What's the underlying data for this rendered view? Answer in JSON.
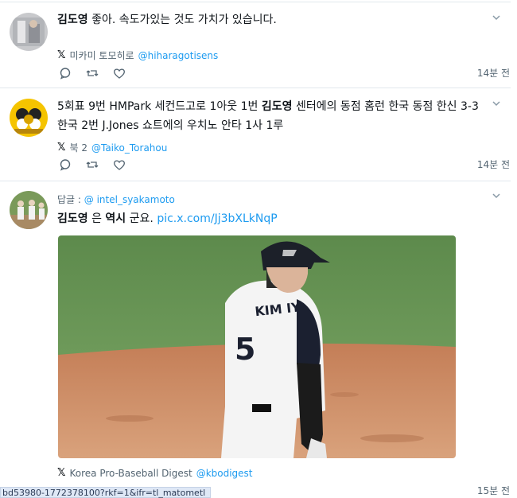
{
  "tweets": [
    {
      "author": "김도영",
      "text": " 좋아. 속도가있는 것도 가치가 있습니다.",
      "source_name": "미카미 토모히로",
      "source_handle": "@hiharagotisens",
      "time": "14분 전"
    },
    {
      "line1_pre": "5회표 9번 HMPark 세컨드고로 1아웃 1번 ",
      "author": "김도영",
      "line1_post": " 센터에의 동점 홈런 한국 동점 한신 3-3",
      "line2": "한국 2번 J.Jones 쇼트에의 우치노 안타 1사 1루",
      "source_name": "북 2",
      "source_handle": "@Taiko_Torahou",
      "time": "14분 전"
    },
    {
      "reply_label": "답글 :",
      "reply_handle": "@ intel_syakamoto",
      "author": "김도영",
      "mid": " 은 ",
      "bold2": "역시",
      "post": " 군요. ",
      "link": "pic.x.com/Jj3bXLkNqP",
      "photo_jersey_name": "KIM IY",
      "photo_jersey_number": "5",
      "source_name": "Korea Pro-Baseball Digest",
      "source_handle": "@kbodigest",
      "time": "15분 전"
    }
  ],
  "x_logo": "𝕏",
  "status_bar_url": "bd53980-1772378100?rkf=1&ifr=tl_matometl",
  "colors": {
    "link": "#1d9bf0",
    "muted": "#536471",
    "border": "#e1e8ed"
  },
  "icons": [
    "reply-icon",
    "retweet-icon",
    "like-icon",
    "chevron-down-icon",
    "x-logo-icon"
  ]
}
